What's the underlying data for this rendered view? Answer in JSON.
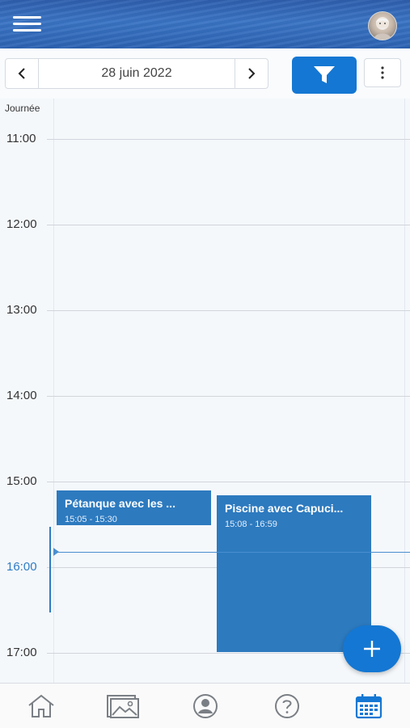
{
  "header": {
    "menu_icon": "hamburger-icon",
    "avatar_icon": "user-avatar"
  },
  "toolbar": {
    "date_label": "28 juin 2022",
    "prev_icon": "chevron-left-icon",
    "next_icon": "chevron-right-icon",
    "filter_icon": "filter-icon",
    "more_icon": "more-vertical-icon",
    "accent_color": "#1477d3"
  },
  "calendar": {
    "allday_label": "Journée",
    "hours": [
      "11:00",
      "12:00",
      "13:00",
      "14:00",
      "15:00",
      "16:00",
      "17:00"
    ],
    "current_hour": "16:00",
    "events": [
      {
        "title": "Pétanque avec les ...",
        "time": "15:05 - 15:30"
      },
      {
        "title": "Piscine avec Capuci...",
        "time": "15:08 - 16:59"
      }
    ],
    "event_color": "#2d7abf"
  },
  "fab": {
    "icon": "plus-icon"
  },
  "bottom_nav": {
    "tabs": [
      {
        "icon": "home-icon",
        "active": false
      },
      {
        "icon": "gallery-icon",
        "active": false
      },
      {
        "icon": "profile-icon",
        "active": false
      },
      {
        "icon": "help-icon",
        "active": false
      },
      {
        "icon": "calendar-icon",
        "active": true
      }
    ],
    "active_color": "#1477d3",
    "inactive_color": "#7a7f85"
  }
}
